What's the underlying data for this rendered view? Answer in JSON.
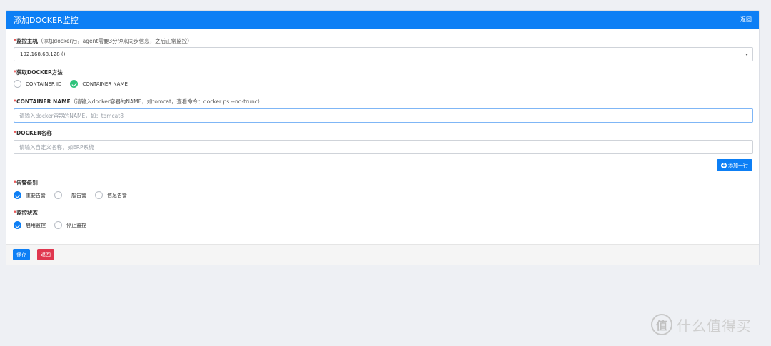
{
  "header": {
    "title": "添加DOCKER监控",
    "back_label": "返回"
  },
  "host": {
    "label": "监控主机",
    "hint": "（添加docker后，agent需要3分钟来同步信息，之后正常监控）",
    "selected": "192.168.68.128 ()"
  },
  "method": {
    "label": "获取DOCKER方法",
    "options": [
      {
        "label": "CONTAINER ID",
        "checked": false
      },
      {
        "label": "CONTAINER NAME",
        "checked": true
      }
    ]
  },
  "container_name": {
    "label": "CONTAINER NAME",
    "hint": "（请输入docker容器的NAME，如tomcat，查看命令：docker ps --no-trunc）",
    "placeholder": "请输入docker容器的NAME，如：tomcat8",
    "value": ""
  },
  "docker_name": {
    "label": "DOCKER名称",
    "placeholder": "请输入自定义名称，如ERP系统",
    "value": ""
  },
  "add_row_label": "添加一行",
  "alarm_level": {
    "label": "告警级别",
    "options": [
      {
        "label": "重要告警",
        "checked": true
      },
      {
        "label": "一般告警",
        "checked": false
      },
      {
        "label": "信息告警",
        "checked": false
      }
    ]
  },
  "monitor_status": {
    "label": "监控状态",
    "options": [
      {
        "label": "启用监控",
        "checked": true
      },
      {
        "label": "停止监控",
        "checked": false
      }
    ]
  },
  "footer": {
    "save_label": "保存",
    "back_label": "返回"
  },
  "watermark": {
    "logo_char": "值",
    "text": "什么值得买"
  },
  "colors": {
    "primary": "#0d7ff5",
    "success": "#2dc27a",
    "danger": "#e0374f",
    "required": "#e53333"
  }
}
